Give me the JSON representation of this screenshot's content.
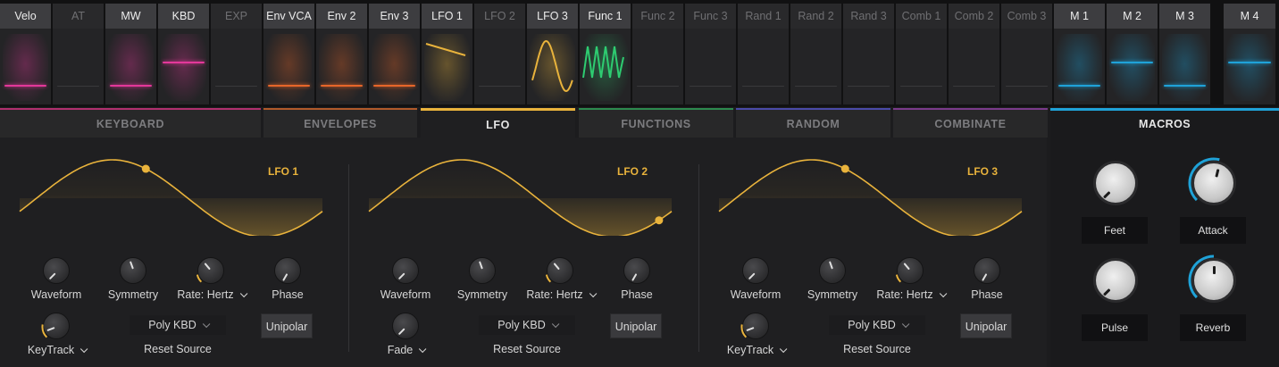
{
  "sources": [
    {
      "label": "Velo",
      "active": true,
      "color": "#e3389a"
    },
    {
      "label": "AT",
      "active": false,
      "color": ""
    },
    {
      "label": "MW",
      "active": true,
      "color": "#e3389a"
    },
    {
      "label": "KBD",
      "active": true,
      "color": "#e3389a"
    },
    {
      "label": "EXP",
      "active": false,
      "color": ""
    },
    {
      "label": "Env VCA",
      "active": true,
      "color": "#e6662a"
    },
    {
      "label": "Env 2",
      "active": true,
      "color": "#e6662a"
    },
    {
      "label": "Env 3",
      "active": true,
      "color": "#e6662a"
    },
    {
      "label": "LFO 1",
      "active": true,
      "color": "#e9b33c"
    },
    {
      "label": "LFO 2",
      "active": false,
      "color": ""
    },
    {
      "label": "LFO 3",
      "active": true,
      "color": "#e9b33c"
    },
    {
      "label": "Func 1",
      "active": true,
      "color": "#2ecc71"
    },
    {
      "label": "Func 2",
      "active": false,
      "color": ""
    },
    {
      "label": "Func 3",
      "active": false,
      "color": ""
    },
    {
      "label": "Rand 1",
      "active": false,
      "color": ""
    },
    {
      "label": "Rand 2",
      "active": false,
      "color": ""
    },
    {
      "label": "Rand 3",
      "active": false,
      "color": ""
    },
    {
      "label": "Comb 1",
      "active": false,
      "color": ""
    },
    {
      "label": "Comb 2",
      "active": false,
      "color": ""
    },
    {
      "label": "Comb 3",
      "active": false,
      "color": ""
    },
    {
      "label": "M 1",
      "active": true,
      "color": "#1fa2d8"
    },
    {
      "label": "M 2",
      "active": true,
      "color": "#1fa2d8"
    },
    {
      "label": "M 3",
      "active": true,
      "color": "#1fa2d8"
    },
    {
      "label": "M 4",
      "active": true,
      "color": "#1fa2d8"
    }
  ],
  "tabs": [
    {
      "label": "KEYBOARD",
      "color": "#b0306e",
      "active": false
    },
    {
      "label": "ENVELOPES",
      "color": "#b05a2a",
      "active": false
    },
    {
      "label": "LFO",
      "color": "#e9b33c",
      "active": true
    },
    {
      "label": "FUNCTIONS",
      "color": "#2d8a4e",
      "active": false
    },
    {
      "label": "RANDOM",
      "color": "#4a4aa8",
      "active": false
    },
    {
      "label": "COMBINATE",
      "color": "#7a3a8a",
      "active": false
    }
  ],
  "lfos": [
    {
      "title": "LFO 1",
      "dot_phase": 0.42,
      "waveform_label": "Waveform",
      "symmetry_label": "Symmetry",
      "rate_label": "Rate: Hertz",
      "phase_label": "Phase",
      "bottom_knob_label": "KeyTrack",
      "source_value": "Poly KBD",
      "source_label": "Reset Source",
      "button_label": "Unipolar"
    },
    {
      "title": "LFO 2",
      "dot_phase": 0.96,
      "waveform_label": "Waveform",
      "symmetry_label": "Symmetry",
      "rate_label": "Rate: Hertz",
      "phase_label": "Phase",
      "bottom_knob_label": "Fade",
      "source_value": "Poly KBD",
      "source_label": "Reset Source",
      "button_label": "Unipolar"
    },
    {
      "title": "LFO 3",
      "dot_phase": 0.42,
      "waveform_label": "Waveform",
      "symmetry_label": "Symmetry",
      "rate_label": "Rate: Hertz",
      "phase_label": "Phase",
      "bottom_knob_label": "KeyTrack",
      "source_value": "Poly KBD",
      "source_label": "Reset Source",
      "button_label": "Unipolar"
    }
  ],
  "macros": {
    "title": "MACROS",
    "items": [
      {
        "label": "Feet",
        "value": 0.0
      },
      {
        "label": "Attack",
        "value": 0.55
      },
      {
        "label": "Pulse",
        "value": 0.0
      },
      {
        "label": "Reverb",
        "value": 0.5
      }
    ],
    "accent": "#1fa2d8"
  },
  "colors": {
    "lfo_accent": "#e9b33c",
    "macro_accent": "#1fa2d8"
  }
}
